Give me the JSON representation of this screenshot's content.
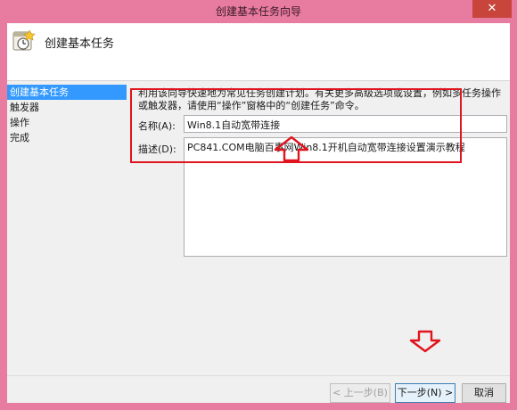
{
  "window": {
    "title": "创建基本任务向导",
    "close_glyph": "✕"
  },
  "header": {
    "title": "创建基本任务",
    "icon": "task-clock-icon"
  },
  "nav": {
    "items": [
      {
        "label": "创建基本任务",
        "active": true
      },
      {
        "label": "触发器",
        "active": false
      },
      {
        "label": "操作",
        "active": false
      },
      {
        "label": "完成",
        "active": false
      }
    ]
  },
  "main": {
    "description": "利用该向导快速地为常见任务创建计划。有关更多高级选项或设置，例如多任务操作或触发器，请使用“操作”窗格中的“创建任务”命令。",
    "name_label": "名称(A):",
    "name_value": "Win8.1自动宽带连接",
    "desc_label": "描述(D):",
    "desc_value": "PC841.COM电脑百事网Win8.1开机自动宽带连接设置演示教程"
  },
  "footer": {
    "back_label": "< 上一步(B)",
    "next_label": "下一步(N) >",
    "cancel_label": "取消"
  },
  "colors": {
    "window_frame": "#e77ba0",
    "close_button": "#c7453a",
    "nav_active": "#3399ff",
    "annotation_red": "#e0141e"
  }
}
